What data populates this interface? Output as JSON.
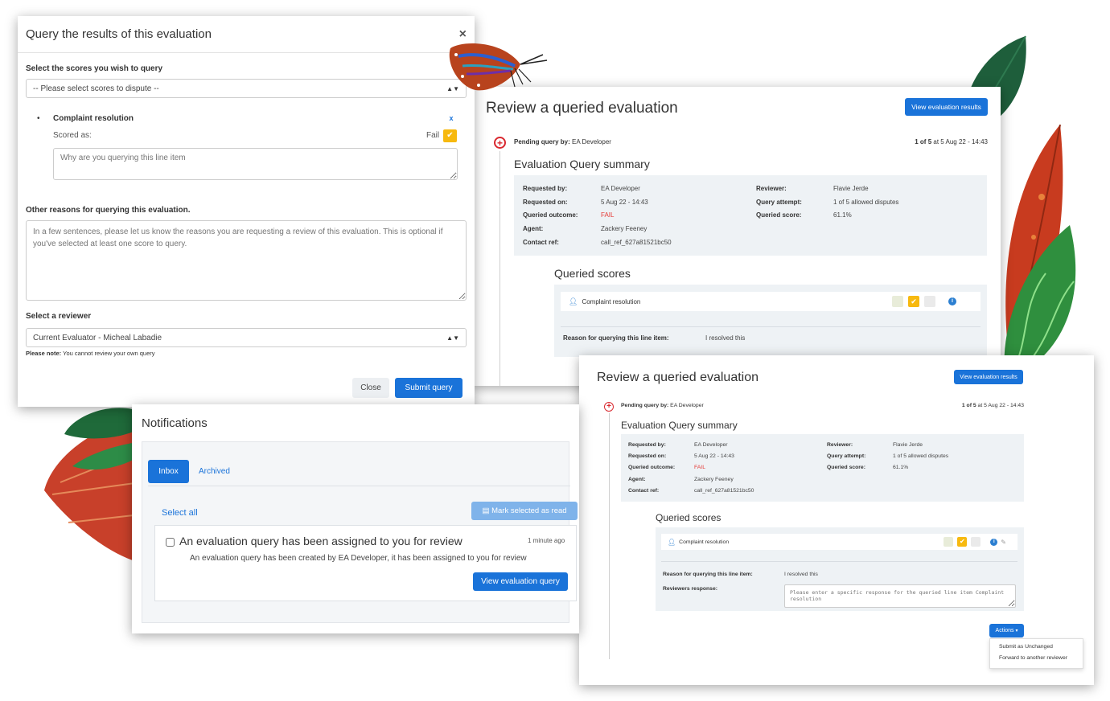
{
  "query_modal": {
    "title": "Query the results of this evaluation",
    "close_icon": "×",
    "scores_label": "Select the scores you wish to query",
    "scores_placeholder": "-- Please select scores to dispute --",
    "item_name": "Complaint resolution",
    "remove_icon": "x",
    "scored_as_label": "Scored as:",
    "scored_as_value": "Fail",
    "reason_placeholder": "Why are you querying this line item",
    "other_reasons_label": "Other reasons for querying this evaluation.",
    "other_reasons_placeholder": "In a few sentences, please let us know the reasons you are requesting a review of this evaluation. This is optional if you've selected at least one score to query.",
    "reviewer_label": "Select a reviewer",
    "reviewer_value": "Current Evaluator - Micheal Labadie",
    "note_bold": "Please note:",
    "note_text": " You cannot review your own query",
    "close_button": "Close",
    "submit_button": "Submit query"
  },
  "review": {
    "title": "Review a queried evaluation",
    "view_results_button": "View evaluation results",
    "pending_label": "Pending query by:",
    "pending_value": " EA Developer",
    "attempt_count": "1 of 5",
    "attempt_date": " at 5 Aug 22 - 14:43",
    "summary_title": "Evaluation Query summary",
    "summary": {
      "requested_by_label": "Requested by:",
      "requested_by": "EA Developer",
      "requested_on_label": "Requested on:",
      "requested_on": "5 Aug 22 - 14:43",
      "queried_outcome_label": "Queried outcome:",
      "queried_outcome": "FAIL",
      "agent_label": "Agent:",
      "agent": "Zackery Feeney",
      "contact_ref_label": "Contact ref:",
      "contact_ref": "call_ref_627a81521bc50",
      "reviewer_label": "Reviewer:",
      "reviewer": "Flavie Jerde",
      "query_attempt_label": "Query attempt:",
      "query_attempt": "1 of 5 allowed disputes",
      "queried_score_label": "Queried score:",
      "queried_score": "61.1%"
    },
    "queried_scores_title": "Queried scores",
    "score_item": "Complaint resolution",
    "reason_label": "Reason for querying this line item:",
    "reason_value": "I resolved this",
    "reviewers_response_label": "Reviewers response:",
    "reviewers_response_placeholder": "Please enter a specific response for the queried line item Complaint resolution",
    "actions_button": "Actions",
    "actions_menu": [
      "Submit as Unchanged",
      "Forward to another reviewer"
    ]
  },
  "notifications": {
    "title": "Notifications",
    "tabs": [
      "Inbox",
      "Archived"
    ],
    "select_all": "Select all",
    "mark_read": "Mark selected as read",
    "item_title": "An evaluation query has been assigned to you for review",
    "item_time": "1 minute ago",
    "item_body": "An evaluation query has been created by EA Developer, it has been assigned to you for review",
    "item_button": "View evaluation query"
  },
  "colors": {
    "primary": "#1a73d9",
    "fail": "#e53935",
    "warning": "#f7b90f",
    "accent_red": "#d9272e"
  },
  "icons": {
    "check": "✔",
    "info": "i",
    "user": "user-icon",
    "plus": "+",
    "pencil": "✎",
    "caret": "▾",
    "inbox": "▤"
  }
}
